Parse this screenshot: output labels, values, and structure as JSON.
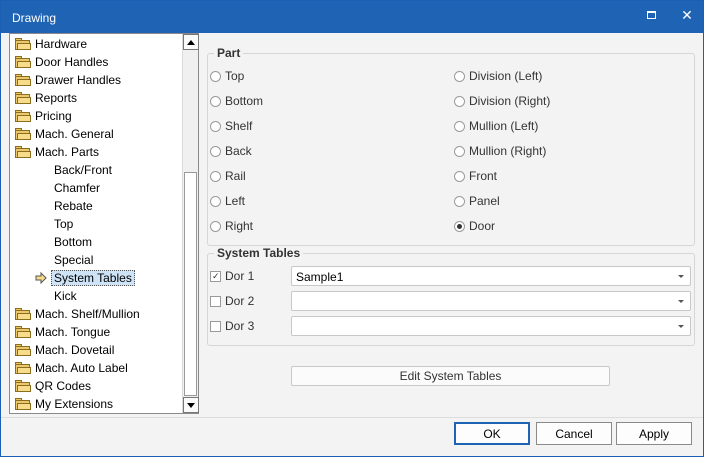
{
  "window": {
    "title": "Drawing"
  },
  "tree": {
    "items": [
      {
        "label": "Hardware",
        "type": "folder"
      },
      {
        "label": "Door Handles",
        "type": "folder"
      },
      {
        "label": "Drawer Handles",
        "type": "folder"
      },
      {
        "label": "Reports",
        "type": "folder"
      },
      {
        "label": "Pricing",
        "type": "folder"
      },
      {
        "label": "Mach. General",
        "type": "folder"
      },
      {
        "label": "Mach. Parts",
        "type": "folder"
      },
      {
        "label": "Back/Front",
        "type": "child"
      },
      {
        "label": "Chamfer",
        "type": "child"
      },
      {
        "label": "Rebate",
        "type": "child"
      },
      {
        "label": "Top",
        "type": "child"
      },
      {
        "label": "Bottom",
        "type": "child"
      },
      {
        "label": "Special",
        "type": "child"
      },
      {
        "label": "System Tables",
        "type": "child",
        "selected": true
      },
      {
        "label": "Kick",
        "type": "child"
      },
      {
        "label": "Mach. Shelf/Mullion",
        "type": "folder"
      },
      {
        "label": "Mach. Tongue",
        "type": "folder"
      },
      {
        "label": "Mach. Dovetail",
        "type": "folder"
      },
      {
        "label": "Mach. Auto Label",
        "type": "folder"
      },
      {
        "label": "QR Codes",
        "type": "folder"
      },
      {
        "label": "My Extensions",
        "type": "folder"
      }
    ]
  },
  "part": {
    "title": "Part",
    "left_options": [
      "Top",
      "Bottom",
      "Shelf",
      "Back",
      "Rail",
      "Left",
      "Right"
    ],
    "right_options": [
      "Division (Left)",
      "Division (Right)",
      "Mullion (Left)",
      "Mullion (Right)",
      "Front",
      "Panel",
      "Door"
    ],
    "selected": "Door"
  },
  "system_tables": {
    "title": "System Tables",
    "rows": [
      {
        "label": "Dor 1",
        "checked": true,
        "value": "Sample1"
      },
      {
        "label": "Dor 2",
        "checked": false,
        "value": ""
      },
      {
        "label": "Dor 3",
        "checked": false,
        "value": ""
      }
    ],
    "edit_button": "Edit System Tables"
  },
  "footer": {
    "ok": "OK",
    "cancel": "Cancel",
    "apply": "Apply"
  },
  "colors": {
    "titlebar": "#1e63b4",
    "selection": "#cfe3f7",
    "folder": "#ecc86a"
  }
}
